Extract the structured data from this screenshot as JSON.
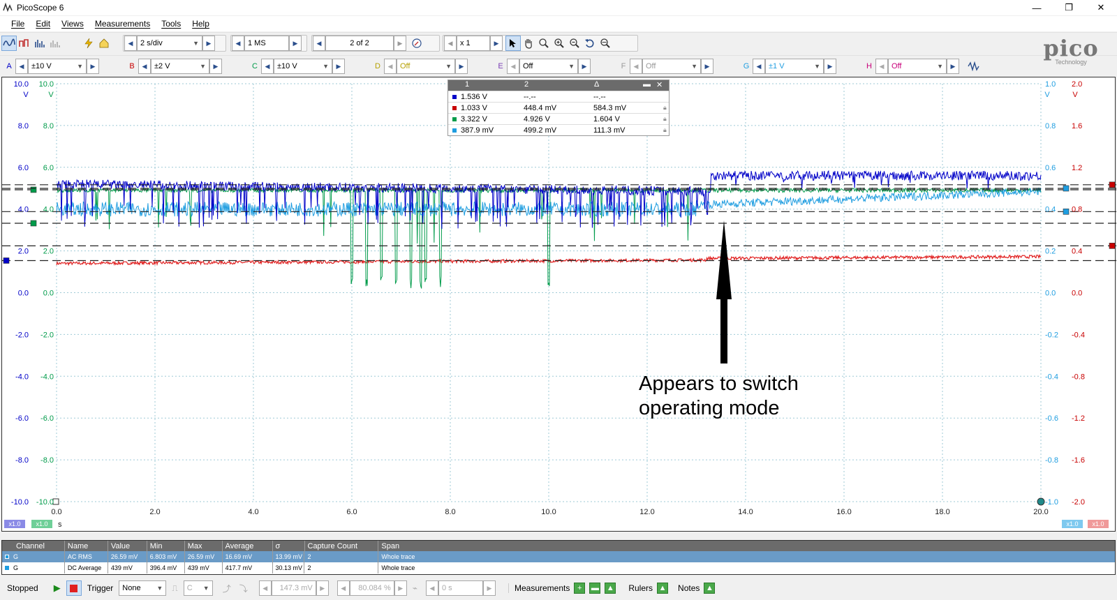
{
  "window": {
    "title": "PicoScope 6",
    "min": "—",
    "max": "❐",
    "close": "✕"
  },
  "menu": [
    "File",
    "Edit",
    "Views",
    "Measurements",
    "Tools",
    "Help"
  ],
  "toolbar": {
    "timebase": "2 s/div",
    "samples": "1 MS",
    "buffer": "2 of 2",
    "zoom": "x 1"
  },
  "channels": [
    {
      "letter": "A",
      "range": "±10 V",
      "color": "#0000c8",
      "enabled": true
    },
    {
      "letter": "B",
      "range": "±2 V",
      "color": "#c80000",
      "enabled": true
    },
    {
      "letter": "C",
      "range": "±10 V",
      "color": "#009b4a",
      "enabled": true
    },
    {
      "letter": "D",
      "range": "Off",
      "color": "#b5a000",
      "enabled": false
    },
    {
      "letter": "E",
      "range": "Off",
      "color": "#7a3fb5",
      "enabled": false
    },
    {
      "letter": "F",
      "range": "Off",
      "color": "#999999",
      "enabled": false
    },
    {
      "letter": "G",
      "range": "±1 V",
      "color": "#1e9de0",
      "enabled": true
    },
    {
      "letter": "H",
      "range": "Off",
      "color": "#c8007a",
      "enabled": false
    }
  ],
  "logo": {
    "brand": "pico",
    "tagline": "Technology"
  },
  "axes": {
    "left_outer": [
      "10.0",
      "8.0",
      "6.0",
      "4.0",
      "2.0",
      "0.0",
      "-2.0",
      "-4.0",
      "-6.0",
      "-8.0",
      "-10.0"
    ],
    "left_inner": [
      "10.0",
      "8.0",
      "6.0",
      "4.0",
      "2.0",
      "0.0",
      "-2.0",
      "-4.0",
      "-6.0",
      "-8.0",
      "-10.0"
    ],
    "right_inner": [
      "1.0",
      "0.8",
      "0.6",
      "0.4",
      "0.2",
      "0.0",
      "-0.2",
      "-0.4",
      "-0.6",
      "-0.8",
      "-1.0"
    ],
    "right_outer": [
      "2.0",
      "1.6",
      "1.2",
      "0.8",
      "0.4",
      "0.0",
      "-0.4",
      "-0.8",
      "-1.2",
      "-1.6",
      "-2.0"
    ],
    "x_ticks": [
      "0.0",
      "2.0",
      "4.0",
      "6.0",
      "8.0",
      "10.0",
      "12.0",
      "14.0",
      "16.0",
      "18.0",
      "20.0"
    ],
    "x_unit": "s",
    "left_unit": "V",
    "right_unit": "V",
    "left_scale_a": "x1.0",
    "left_scale_c": "x1.0",
    "right_scale_g": "x1.0",
    "right_scale_b": "x1.0"
  },
  "annotation": {
    "line1": "Appears to switch",
    "line2": "operating mode"
  },
  "ruler_table": {
    "headers": [
      "1",
      "2",
      "Δ"
    ],
    "rows": [
      {
        "color": "#0000c8",
        "v1": "1.536 V",
        "v2": "--.--",
        "d": "--.--"
      },
      {
        "color": "#c80000",
        "v1": "1.033 V",
        "v2": "448.4 mV",
        "d": "584.3 mV"
      },
      {
        "color": "#009b4a",
        "v1": "3.322 V",
        "v2": "4.926 V",
        "d": "1.604 V"
      },
      {
        "color": "#1e9de0",
        "v1": "387.9 mV",
        "v2": "499.2 mV",
        "d": "111.3 mV"
      }
    ]
  },
  "measurements": {
    "headers": [
      "Channel",
      "Name",
      "Value",
      "Min",
      "Max",
      "Average",
      "σ",
      "Capture Count",
      "Span"
    ],
    "rows": [
      {
        "channel": "G",
        "name": "AC RMS",
        "value": "26.59 mV",
        "min": "6.803 mV",
        "max": "26.59 mV",
        "avg": "16.69 mV",
        "sigma": "13.99 mV",
        "count": "2",
        "span": "Whole trace"
      },
      {
        "channel": "G",
        "name": "DC Average",
        "value": "439 mV",
        "min": "396.4 mV",
        "max": "439 mV",
        "avg": "417.7 mV",
        "sigma": "30.13 mV",
        "count": "2",
        "span": "Whole trace"
      }
    ]
  },
  "status": {
    "state": "Stopped",
    "trigger_label": "Trigger",
    "trigger_mode": "None",
    "trigger_source": "C",
    "threshold": "147.3 mV",
    "pretrigger": "80.084 %",
    "delay": "0 s",
    "measurements_label": "Measurements",
    "rulers_label": "Rulers",
    "notes_label": "Notes"
  }
}
